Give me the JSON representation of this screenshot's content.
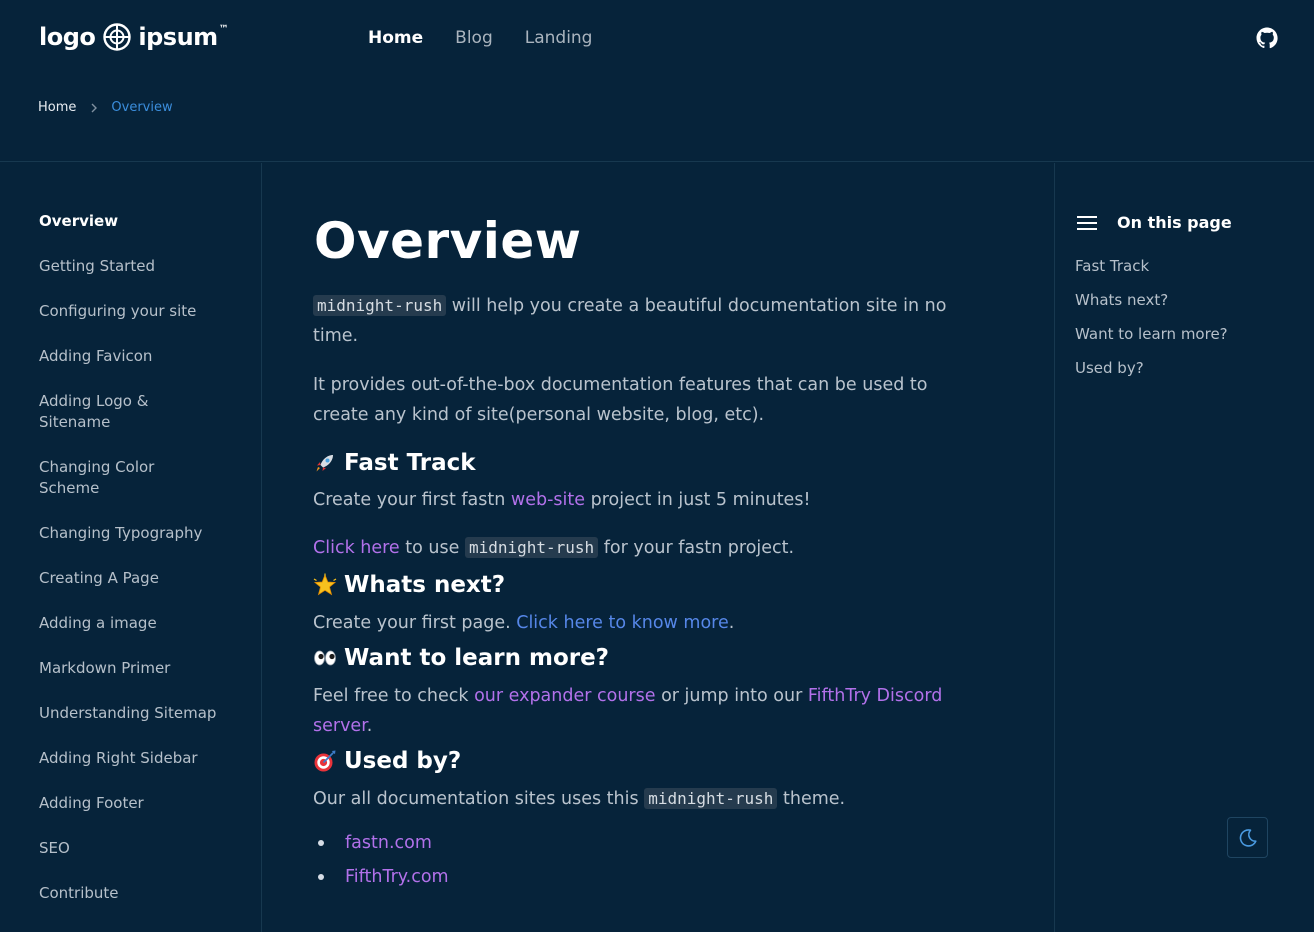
{
  "header": {
    "logo": {
      "left": "logo",
      "right": "ipsum",
      "tm": "™"
    },
    "nav": [
      {
        "label": "Home",
        "active": true
      },
      {
        "label": "Blog",
        "active": false
      },
      {
        "label": "Landing",
        "active": false
      }
    ],
    "github_icon": "github-icon"
  },
  "breadcrumb": {
    "home": "Home",
    "current": "Overview"
  },
  "sidebar": {
    "items": [
      {
        "label": "Overview",
        "active": true
      },
      {
        "label": "Getting Started"
      },
      {
        "label": "Configuring your site"
      },
      {
        "label": "Adding Favicon"
      },
      {
        "label": "Adding Logo & Sitename"
      },
      {
        "label": "Changing Color Scheme"
      },
      {
        "label": "Changing Typography"
      },
      {
        "label": "Creating A Page"
      },
      {
        "label": "Adding a image"
      },
      {
        "label": "Markdown Primer"
      },
      {
        "label": "Understanding Sitemap"
      },
      {
        "label": "Adding Right Sidebar"
      },
      {
        "label": "Adding Footer"
      },
      {
        "label": "SEO"
      },
      {
        "label": "Contribute"
      }
    ]
  },
  "main": {
    "title": "Overview",
    "intro": {
      "code": "midnight-rush",
      "text1": " will help you create a beautiful documentation site in no",
      "text2": "time."
    },
    "intro2": {
      "line1": "It provides out-of-the-box documentation features that can be used to",
      "line2": "create any kind of site(personal website, blog, etc)."
    },
    "fast_track": {
      "heading": "Fast Track",
      "emoji": "rocket-emoji",
      "p1_before": "Create your first fastn ",
      "p1_link": "web-site",
      "p1_after": " project in just 5 minutes!",
      "p2_link": "Click here",
      "p2_mid": " to use ",
      "p2_code": "midnight-rush",
      "p2_after": " for your fastn project."
    },
    "whats_next": {
      "heading": "Whats next?",
      "emoji": "star-emoji",
      "before": "Create your first page. ",
      "link": "Click here to know more",
      "after": "."
    },
    "learn_more": {
      "heading": "Want to learn more?",
      "emoji": "eyes-emoji",
      "before": "Feel free to check ",
      "link1": "our expander course",
      "mid": " or jump into our ",
      "link2a": "FifthTry Discord",
      "link2b": "server",
      "after": "."
    },
    "used_by": {
      "heading": "Used by?",
      "emoji": "target-emoji",
      "before": "Our all documentation sites uses this ",
      "code": "midnight-rush",
      "after": " theme.",
      "sites": [
        "fastn.com",
        "FifthTry.com"
      ]
    }
  },
  "toc": {
    "heading": "On this page",
    "items": [
      "Fast Track",
      "Whats next?",
      "Want to learn more?",
      "Used by?"
    ]
  },
  "theme_toggle": {
    "icon": "moon-icon"
  },
  "colors": {
    "background": "#06233a",
    "accent_purple": "#b271ea",
    "accent_blue": "#5687e8",
    "breadcrumb_active": "#3b8ddb"
  }
}
